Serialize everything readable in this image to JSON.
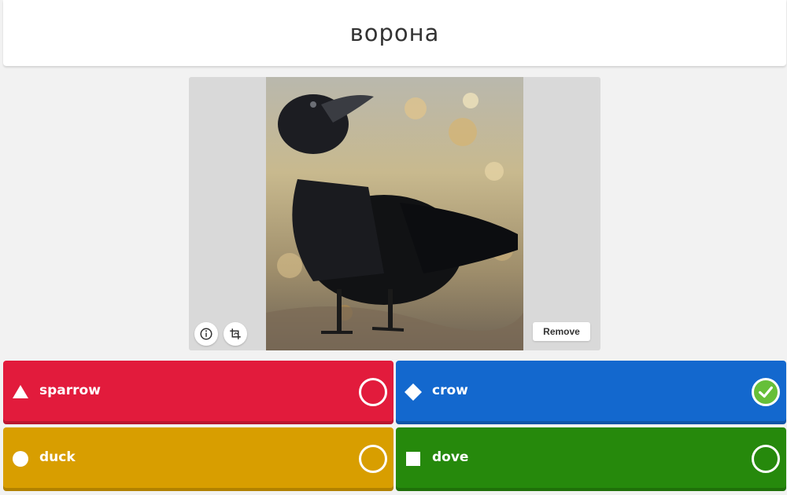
{
  "question": {
    "title": "ворона"
  },
  "media": {
    "image_icon": "crow-photo",
    "info_icon": "info-icon",
    "crop_icon": "crop-icon",
    "remove_label": "Remove"
  },
  "answers": [
    {
      "label": "sparrow",
      "color": "#e21b3c",
      "shape": "triangle",
      "correct": false
    },
    {
      "label": "crow",
      "color": "#1368ce",
      "shape": "diamond",
      "correct": true
    },
    {
      "label": "duck",
      "color": "#d89e00",
      "shape": "circle",
      "correct": false
    },
    {
      "label": "dove",
      "color": "#26890c",
      "shape": "square",
      "correct": false
    }
  ],
  "colors": {
    "correct_check": "#66bf39",
    "background": "#f2f2f2"
  }
}
